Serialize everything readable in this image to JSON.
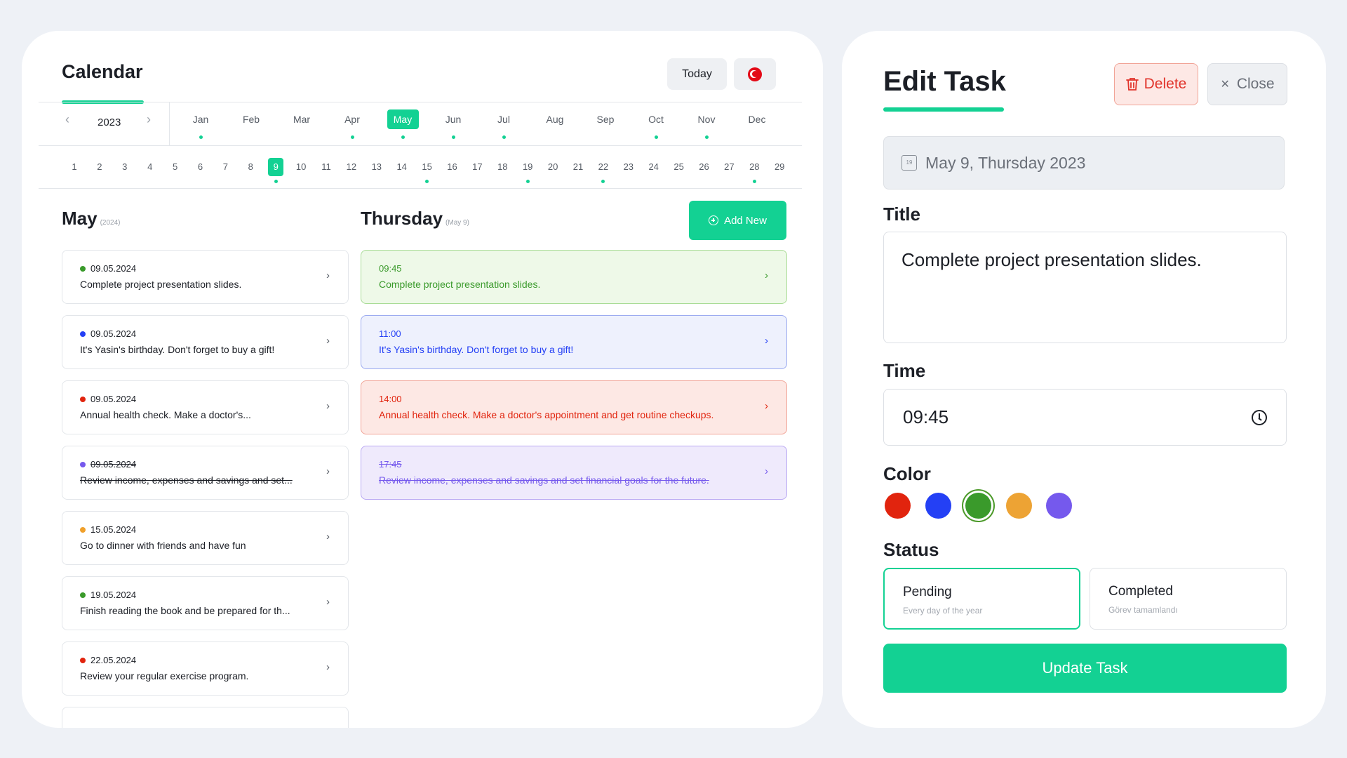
{
  "calendar": {
    "title": "Calendar",
    "today_label": "Today",
    "year": "2023",
    "months": [
      {
        "label": "Jan",
        "dot": true
      },
      {
        "label": "Feb",
        "dot": false
      },
      {
        "label": "Mar",
        "dot": false
      },
      {
        "label": "Apr",
        "dot": true
      },
      {
        "label": "May",
        "dot": true,
        "active": true
      },
      {
        "label": "Jun",
        "dot": true
      },
      {
        "label": "Jul",
        "dot": true
      },
      {
        "label": "Aug",
        "dot": false
      },
      {
        "label": "Sep",
        "dot": false
      },
      {
        "label": "Oct",
        "dot": true
      },
      {
        "label": "Nov",
        "dot": true
      },
      {
        "label": "Dec",
        "dot": false
      }
    ],
    "days": [
      "1",
      "2",
      "3",
      "4",
      "5",
      "6",
      "7",
      "8",
      "9",
      "10",
      "11",
      "12",
      "13",
      "14",
      "15",
      "16",
      "17",
      "18",
      "19",
      "20",
      "21",
      "22",
      "23",
      "24",
      "25",
      "26",
      "27",
      "28",
      "29"
    ],
    "active_day": "9",
    "dotted_days": [
      "9",
      "15",
      "19",
      "22",
      "28"
    ]
  },
  "month_section": {
    "title": "May",
    "subtitle": "(2024)",
    "tasks": [
      {
        "date": "09.05.2024",
        "text": "Complete project presentation slides.",
        "color": "#3a9a2b",
        "done": false
      },
      {
        "date": "09.05.2024",
        "text": "It's Yasin's birthday. Don't forget to buy a gift!",
        "color": "#2440f5",
        "done": false
      },
      {
        "date": "09.05.2024",
        "text": "Annual health check. Make a doctor's...",
        "color": "#e1240e",
        "done": false
      },
      {
        "date": "09.05.2024",
        "text": "Review income, expenses and savings and set...",
        "color": "#7559ed",
        "done": true
      },
      {
        "date": "15.05.2024",
        "text": "Go to dinner with friends and have fun",
        "color": "#f0a02b",
        "done": false
      },
      {
        "date": "19.05.2024",
        "text": "Finish reading the book and be prepared for th...",
        "color": "#3a9a2b",
        "done": false
      },
      {
        "date": "22.05.2024",
        "text": "Review your regular exercise program.",
        "color": "#e1240e",
        "done": false
      }
    ]
  },
  "day_section": {
    "title": "Thursday",
    "subtitle": "(May 9)",
    "add_new_label": "Add New",
    "events": [
      {
        "time": "09:45",
        "text": "Complete project presentation slides.",
        "text_color": "#3a9a2b",
        "bg": "#eef9e8",
        "border": "#a9dc96",
        "done": false
      },
      {
        "time": "11:00",
        "text": "It's Yasin's birthday. Don't forget to buy a gift!",
        "text_color": "#2440f5",
        "bg": "#eef1fd",
        "border": "#9cabf0",
        "done": false
      },
      {
        "time": "14:00",
        "text": "Annual health check. Make a doctor's appointment and get routine checkups.",
        "text_color": "#e1240e",
        "bg": "#fde8e4",
        "border": "#f1a497",
        "done": false
      },
      {
        "time": "17:45",
        "text": "Review income, expenses and savings and set financial goals for the future.",
        "text_color": "#7559ed",
        "bg": "#efeafc",
        "border": "#b9a8f3",
        "done": true
      }
    ]
  },
  "edit_task": {
    "title": "Edit Task",
    "delete_label": "Delete",
    "close_label": "Close",
    "date_value": "May 9, Thursday 2023",
    "calendar_icon_day": "19",
    "title_label": "Title",
    "title_value": "Complete project presentation slides.",
    "time_label": "Time",
    "time_value": "09:45",
    "color_label": "Color",
    "colors": [
      "#e1240e",
      "#2440f5",
      "#3a9a2b",
      "#eda334",
      "#7559ed"
    ],
    "selected_color": "#3a9a2b",
    "status_label": "Status",
    "statuses": [
      {
        "title": "Pending",
        "sub": "Every day of the year",
        "selected": true
      },
      {
        "title": "Completed",
        "sub": "Görev tamamlandı",
        "selected": false
      }
    ],
    "update_label": "Update Task"
  },
  "icons": {
    "accent": "#13d193",
    "flag": "turkey-flag-icon",
    "prev": "chevron-left-icon",
    "next": "chevron-right-icon",
    "trash": "trash-icon",
    "close": "close-icon",
    "calendar": "calendar-icon",
    "clock": "clock-icon",
    "plus": "plus-circle-icon"
  }
}
